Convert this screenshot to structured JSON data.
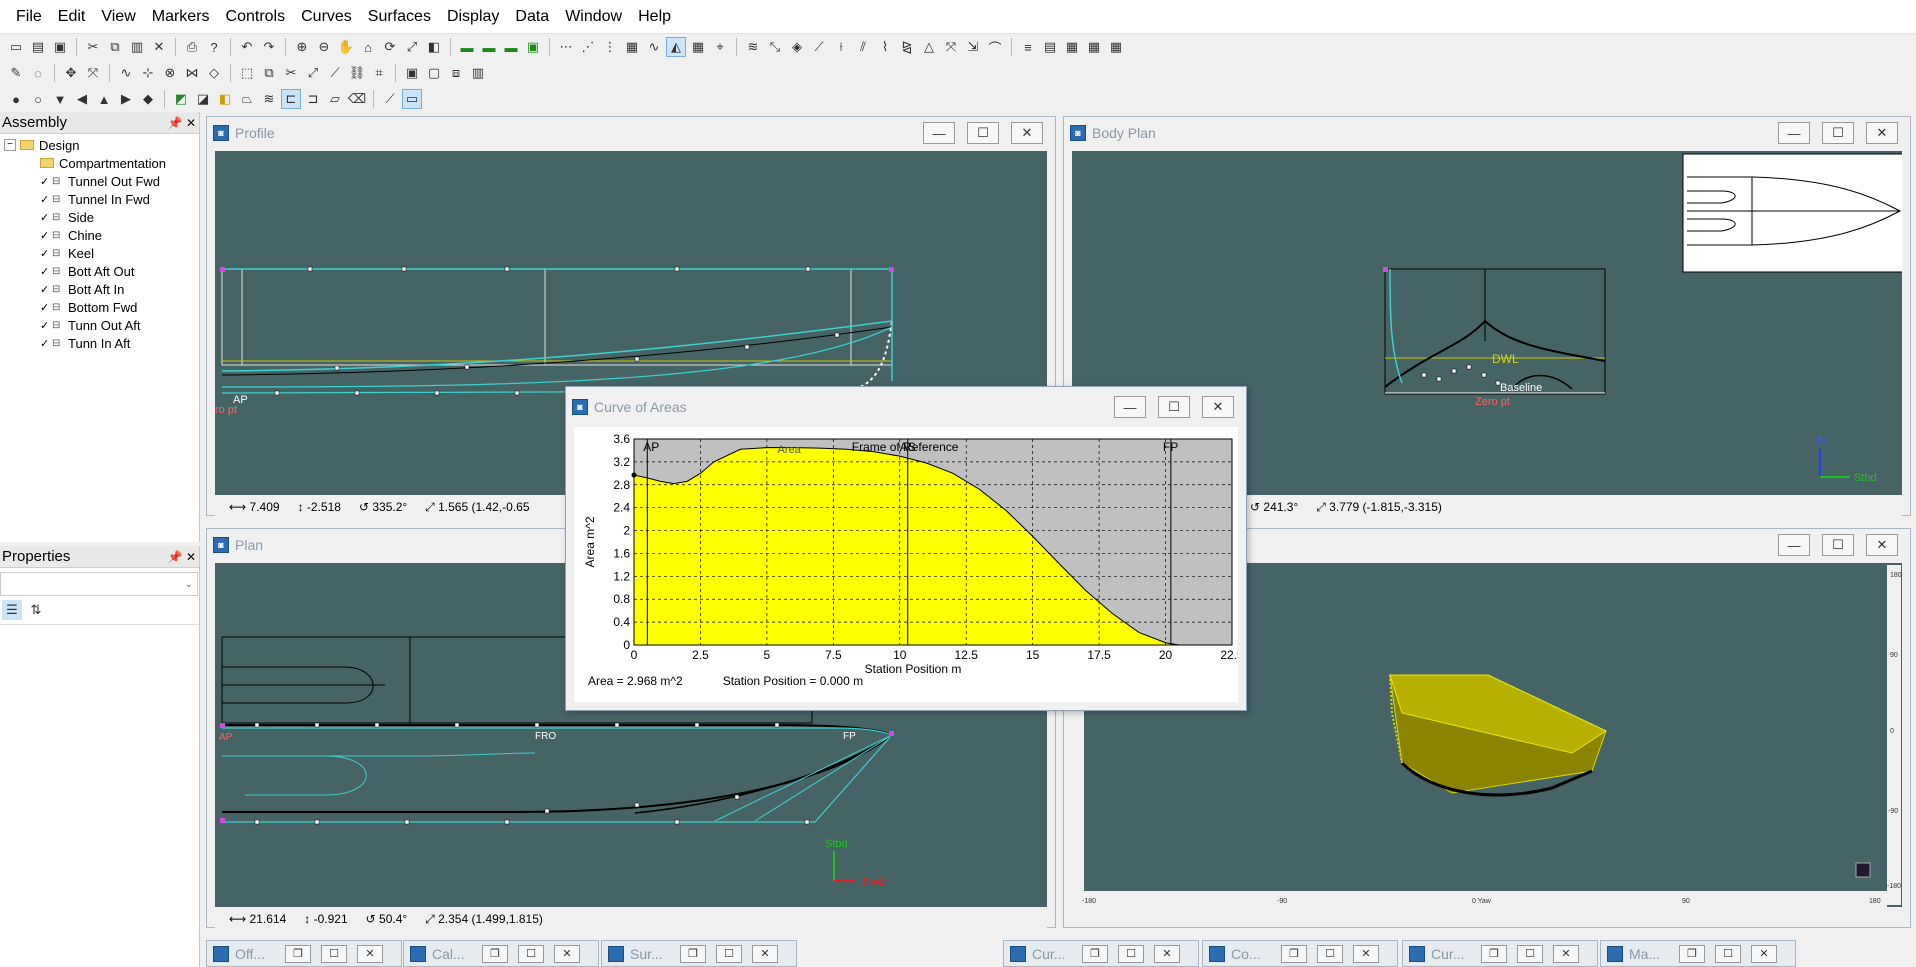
{
  "menu": [
    "File",
    "Edit",
    "View",
    "Markers",
    "Controls",
    "Curves",
    "Surfaces",
    "Display",
    "Data",
    "Window",
    "Help"
  ],
  "assembly": {
    "title": "Assembly",
    "root": "Design",
    "folder": "Compartmentation",
    "items": [
      "Tunnel Out Fwd",
      "Tunnel In Fwd",
      "Side",
      "Chine",
      "Keel",
      "Bott Aft Out",
      "Bott Aft In",
      "Bottom Fwd",
      "Tunn Out Aft",
      "Tunn In Aft"
    ]
  },
  "properties": {
    "title": "Properties"
  },
  "profile": {
    "title": "Profile",
    "status": {
      "x": "7.409",
      "y": "-2.518",
      "angle": "335.2°",
      "dist": "1.565 (1.42,-0.65"
    },
    "labels": {
      "zero": "ro pt",
      "ap": "AP"
    }
  },
  "body_plan": {
    "title": "Body Plan",
    "status": {
      "angle": "241.3°",
      "dist": "3.779 (-1.815,-3.315)"
    },
    "labels": {
      "dwl": "DWL",
      "baseline": "Baseline",
      "zero": "Zero pt",
      "up": "Up",
      "stbd": "Stbd"
    }
  },
  "plan": {
    "title": "Plan",
    "status": {
      "x": "21.614",
      "y": "-0.921",
      "angle": "50.4°",
      "dist": "2.354 (1.499,1.815)"
    },
    "labels": {
      "stbd": "Stbd",
      "fwd": "Fwd",
      "ap": "AP",
      "fp": "FP",
      "frame": "FRO"
    }
  },
  "perspective": {
    "bottom_ticks": [
      "-180",
      "-90",
      "0 Yaw",
      "90",
      "180"
    ],
    "right_ticks": [
      "180",
      "90",
      "0",
      "-90",
      "-180"
    ]
  },
  "curve_of_areas": {
    "title": "Curve of Areas",
    "footer": {
      "area": "Area =  2.968 m^2",
      "station": "Station Position =  0.000 m"
    }
  },
  "chart_data": {
    "type": "area",
    "xlabel": "Station Position  m",
    "ylabel": "Area  m^2",
    "xlim": [
      0,
      22.5
    ],
    "ylim": [
      0,
      3.6
    ],
    "xticks": [
      "0",
      "2.5",
      "5",
      "7.5",
      "10",
      "12.5",
      "15",
      "17.5",
      "20",
      "22.5"
    ],
    "yticks": [
      "0",
      "0.4",
      "0.8",
      "1.2",
      "1.6",
      "2",
      "2.4",
      "2.8",
      "3.2",
      "3.6"
    ],
    "grid": true,
    "series": [
      {
        "name": "Area",
        "x": [
          0,
          0.5,
          1,
          1.5,
          2,
          2.5,
          3,
          4,
          5,
          6,
          7,
          8,
          9,
          10,
          11,
          12,
          13,
          14,
          15,
          16,
          17,
          18,
          19,
          20,
          20.5,
          21
        ],
        "values": [
          2.97,
          2.92,
          2.86,
          2.82,
          2.86,
          3.0,
          3.2,
          3.42,
          3.45,
          3.45,
          3.44,
          3.42,
          3.38,
          3.3,
          3.18,
          3.0,
          2.72,
          2.35,
          1.9,
          1.42,
          0.95,
          0.55,
          0.22,
          0.04,
          0.0,
          0.0
        ]
      }
    ],
    "annotations": [
      {
        "label": "AP",
        "x": 0.5
      },
      {
        "label": "Frame of Reference",
        "x": 10.3
      },
      {
        "label": "AS",
        "x": 10.3
      },
      {
        "label": "FP",
        "x": 20.2
      }
    ],
    "colors": {
      "fill": "#ffff00",
      "background": "#c0c0c0"
    }
  },
  "minimized_windows": [
    "Off...",
    "Cal...",
    "Sur...",
    "Cur...",
    "Co...",
    "Cur...",
    "Ma..."
  ],
  "colors": {
    "viewport": "#466365",
    "cyan": "#3fd0d0",
    "marker": "#ffffff",
    "pink_marker": "#d04de0"
  }
}
